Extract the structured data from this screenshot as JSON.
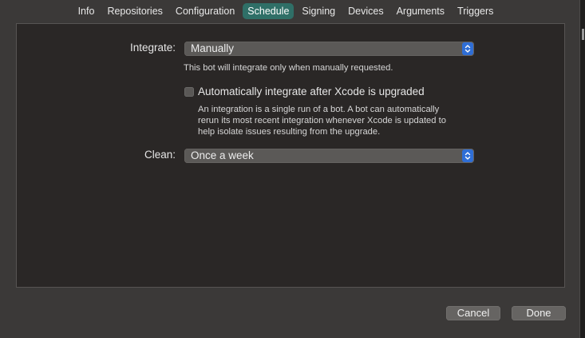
{
  "tabs": [
    {
      "label": "Info",
      "active": false
    },
    {
      "label": "Repositories",
      "active": false
    },
    {
      "label": "Configuration",
      "active": false
    },
    {
      "label": "Schedule",
      "active": true
    },
    {
      "label": "Signing",
      "active": false
    },
    {
      "label": "Devices",
      "active": false
    },
    {
      "label": "Arguments",
      "active": false
    },
    {
      "label": "Triggers",
      "active": false
    }
  ],
  "integrate": {
    "label": "Integrate:",
    "value": "Manually",
    "hint": "This bot will integrate only when manually requested."
  },
  "auto_integrate": {
    "label": "Automatically integrate after Xcode is upgraded",
    "checked": false,
    "hint_lines": [
      "An integration is a single run of a bot. A bot can automatically",
      "rerun its most recent integration whenever Xcode is updated to",
      "help isolate issues resulting from the upgrade."
    ]
  },
  "clean": {
    "label": "Clean:",
    "value": "Once a week"
  },
  "buttons": {
    "cancel": "Cancel",
    "done": "Done"
  },
  "colors": {
    "accent": "#2f6ed6",
    "tab_active": "#2f6f67",
    "panel_bg": "#2a2726",
    "window_bg": "#3b3938"
  }
}
